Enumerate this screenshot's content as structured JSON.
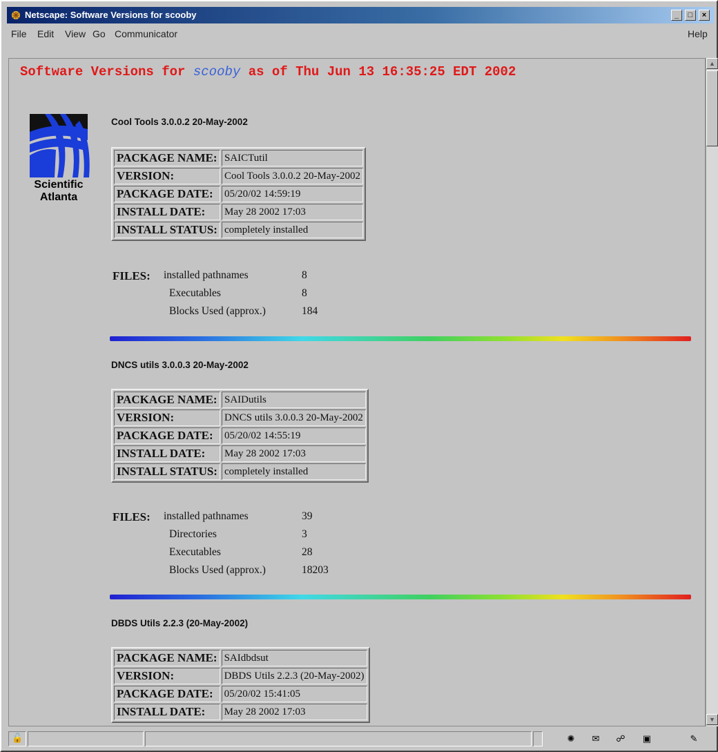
{
  "window": {
    "title": "Netscape: Software Versions for scooby"
  },
  "menu": {
    "file": "File",
    "edit": "Edit",
    "view": "View",
    "go": "Go",
    "communicator": "Communicator",
    "help": "Help"
  },
  "page": {
    "heading_prefix": "Software Versions for",
    "heading_host": "scooby",
    "heading_suffix": "as of Thu Jun 13 16:35:25 EDT 2002",
    "logo_line1": "Scientific",
    "logo_line2": "Atlanta"
  },
  "labels": {
    "package_name": "PACKAGE NAME:",
    "version": "VERSION:",
    "package_date": "PACKAGE DATE:",
    "install_date": "INSTALL DATE:",
    "install_status": "INSTALL STATUS:",
    "files": "FILES:"
  },
  "packages": [
    {
      "title": "Cool Tools 3.0.0.2 20-May-2002",
      "package_name": "SAICTutil",
      "version": "Cool Tools 3.0.0.2 20-May-2002",
      "package_date": "05/20/02 14:59:19",
      "install_date": "May 28 2002 17:03",
      "install_status": "completely installed",
      "files": [
        {
          "name": "installed pathnames",
          "value": "8"
        },
        {
          "name": "Executables",
          "value": "8"
        },
        {
          "name": "Blocks Used (approx.)",
          "value": "184"
        }
      ]
    },
    {
      "title": "DNCS utils 3.0.0.3 20-May-2002",
      "package_name": "SAIDutils",
      "version": "DNCS utils 3.0.0.3 20-May-2002",
      "package_date": "05/20/02 14:55:19",
      "install_date": "May 28 2002 17:03",
      "install_status": "completely installed",
      "files": [
        {
          "name": "installed pathnames",
          "value": "39"
        },
        {
          "name": "Directories",
          "value": "3"
        },
        {
          "name": "Executables",
          "value": "28"
        },
        {
          "name": "Blocks Used (approx.)",
          "value": "18203"
        }
      ]
    },
    {
      "title": "DBDS Utils 2.2.3 (20-May-2002)",
      "package_name": "SAIdbdsut",
      "version": "DBDS Utils 2.2.3 (20-May-2002)",
      "package_date": "05/20/02 15:41:05",
      "install_date": "May 28 2002 17:03"
    }
  ]
}
